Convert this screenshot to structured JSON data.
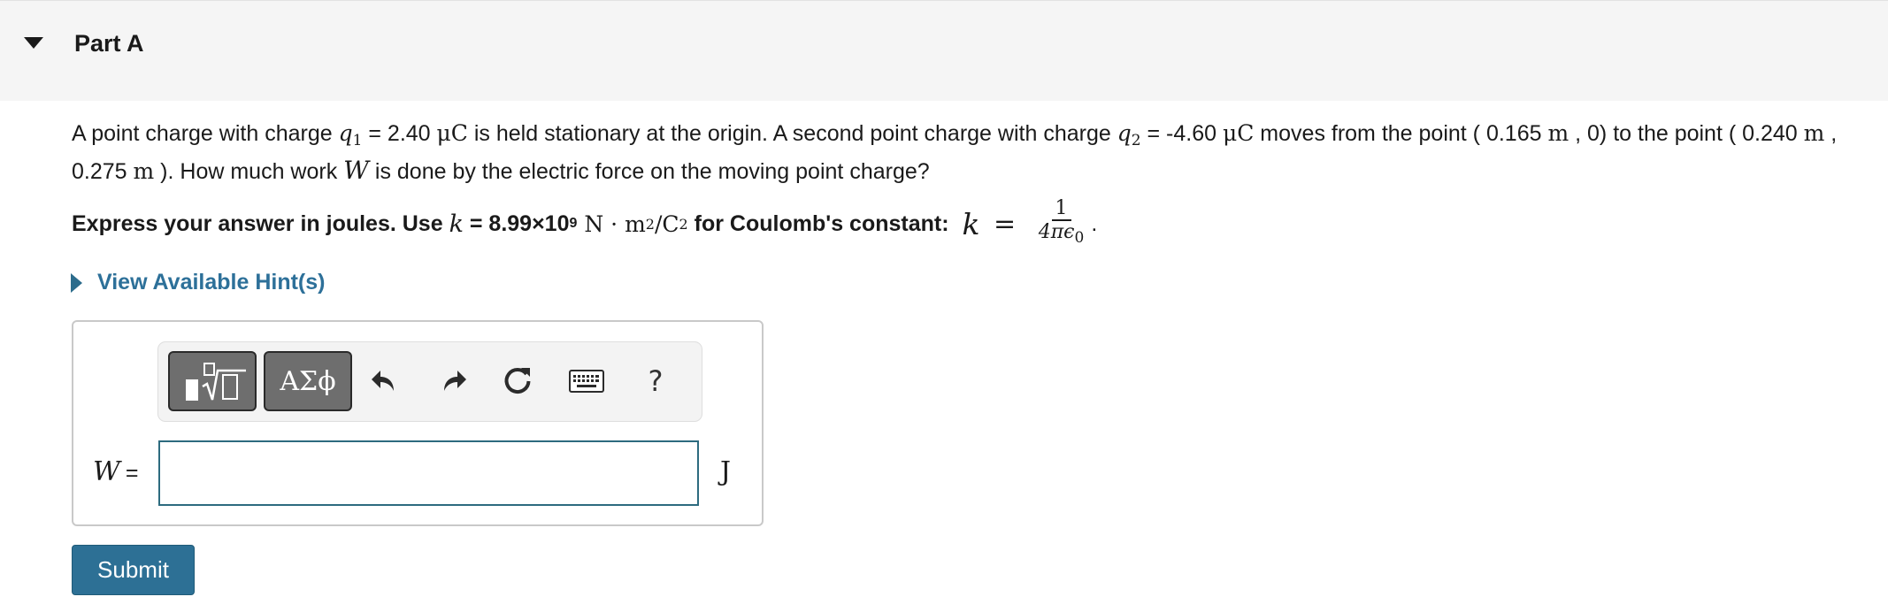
{
  "part": {
    "title": "Part A"
  },
  "problem": {
    "seg1": "A point charge with charge ",
    "q1_var": "q",
    "q1_sub": "1",
    "seg2": " = 2.40 ",
    "q1_unit": "μC",
    "seg3": " is held stationary at the origin. A second point charge with charge ",
    "q2_var": "q",
    "q2_sub": "2",
    "seg4": " = -4.60 ",
    "q2_unit": "μC",
    "seg5": " moves from the point ( 0.165 ",
    "unit_m1": "m",
    "seg6": " , 0) to the point ( 0.240 ",
    "unit_m2": "m",
    "seg7": " , 0.275 ",
    "unit_m3": "m",
    "seg8": " ). How much work ",
    "w_var": "W",
    "seg9": " is done by the electric force on the moving point charge?"
  },
  "instruction": {
    "seg1": "Express your answer in joules. Use ",
    "k_var": "k",
    "seg2": " = 8.99×10",
    "exp": "9",
    "units_a": " N · m",
    "units_sup1": "2",
    "units_b": "/C",
    "units_sup2": "2",
    "seg3": " for Coulomb's constant: ",
    "k_var2": "k",
    "eq": " = ",
    "frac_num": "1",
    "frac_den": "4πϵ",
    "frac_den_sub": "0",
    "period": "."
  },
  "hints": {
    "label": "View Available Hint(s)"
  },
  "toolbar": {
    "templates_icon": "templates-icon",
    "greek_label": "ΑΣϕ",
    "undo_icon": "undo-icon",
    "redo_icon": "redo-icon",
    "reset_icon": "reset-icon",
    "keyboard_icon": "keyboard-icon",
    "help_label": "?"
  },
  "answer": {
    "var_label": "W",
    "equals": "=",
    "value": "",
    "unit": "J"
  },
  "submit": {
    "label": "Submit"
  },
  "colors": {
    "header_bg": "#f5f5f5",
    "link": "#2d7099",
    "submit_bg": "#2d7095",
    "input_border": "#2d6b7f",
    "toolbar_button_bg": "#6e6e6e"
  }
}
